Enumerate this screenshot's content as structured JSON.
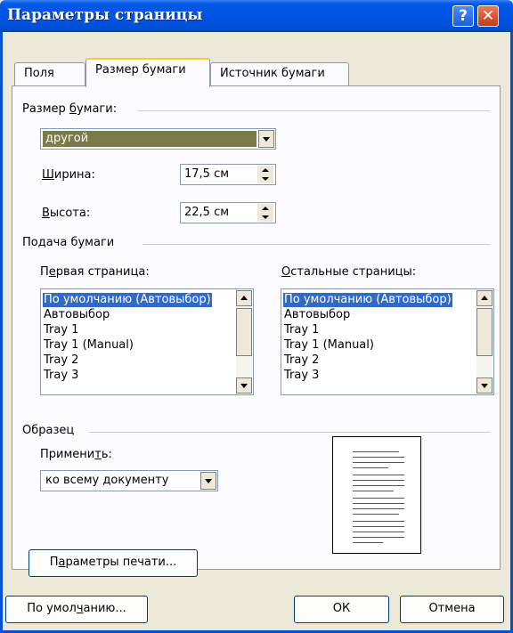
{
  "window": {
    "title": "Параметры страницы",
    "help_glyph": "?",
    "close_glyph": "✕"
  },
  "tabs": [
    {
      "label": "Поля",
      "active": false
    },
    {
      "label": "Размер бумаги",
      "active": true
    },
    {
      "label": "Источник бумаги",
      "active": false
    }
  ],
  "paper_size": {
    "group_label_pre": "Размер ",
    "group_label_u": "б",
    "group_label_post": "умаги:",
    "selected": "другой",
    "width_u": "Ш",
    "width_rest": "ирина:",
    "width_value": "17,5 см",
    "height_u": "В",
    "height_rest": "ысота:",
    "height_value": "22,5 см"
  },
  "paper_source": {
    "group_label": "Подача бумаги",
    "first_page_pre": "П",
    "first_page_u": "е",
    "first_page_post": "рвая страница:",
    "other_pages_u": "О",
    "other_pages_post": "стальные страницы:",
    "first_page_items": [
      "По умолчанию (Автовыбор)",
      "Автовыбор",
      "Tray 1",
      "Tray 1 (Manual)",
      "Tray 2",
      "Tray 3"
    ],
    "other_pages_items": [
      "По умолчанию (Автовыбор)",
      "Автовыбор",
      "Tray 1",
      "Tray 1 (Manual)",
      "Tray 2",
      "Tray 3"
    ],
    "first_selected_index": 0,
    "other_selected_index": 0
  },
  "sample": {
    "group_label": "Образец",
    "apply_pre": "Примени",
    "apply_u": "т",
    "apply_post": "ь:",
    "apply_value": "ко всему документу"
  },
  "print_options_pre": "П",
  "print_options_u": "а",
  "print_options_post": "раметры печати...",
  "footer": {
    "default_pre": "По умол",
    "default_u": "ч",
    "default_post": "анию...",
    "ok_label": "ОК",
    "cancel_label": "Отмена"
  },
  "colors": {
    "titlebar": "#0054e3",
    "selection": "#316ac5",
    "combo_selection": "#7a7a4a",
    "dialog_bg": "#ece9d8"
  }
}
